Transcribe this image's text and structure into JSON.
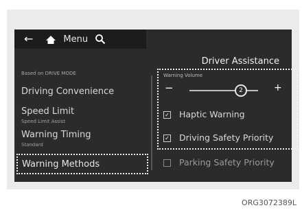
{
  "topbar": {
    "back_icon": "arrow-left-icon",
    "home_icon": "home-icon",
    "menu_label": "Menu",
    "search_icon": "search-icon"
  },
  "header": {
    "title": "Driver Assistance"
  },
  "left_menu": {
    "caption": "Based on DRIVE MODE",
    "items": [
      {
        "label": "Driving Convenience",
        "sub": ""
      },
      {
        "label": "Speed Limit",
        "sub": "Speed Limit Assist"
      },
      {
        "label": "Warning Timing",
        "sub": "Standard"
      },
      {
        "label": "Warning Methods",
        "sub": ""
      }
    ]
  },
  "settings": {
    "warning_volume": {
      "label": "Warning Volume",
      "minus": "−",
      "plus": "+",
      "value": "2",
      "level": 0.75
    },
    "options": [
      {
        "label": "Haptic Warning",
        "checked": true
      },
      {
        "label": "Driving Safety Priority",
        "checked": true
      },
      {
        "label": "Parking Safety Priority",
        "checked": false
      }
    ]
  },
  "figure_code": "ORG3072389L",
  "colors": {
    "screen_bg": "#2b2b2b",
    "highlight": "#f4f4f4"
  }
}
